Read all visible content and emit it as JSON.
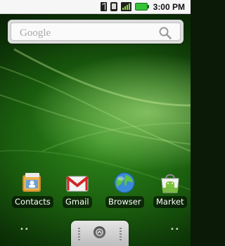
{
  "status_bar": {
    "time": "3:00 PM",
    "icons": [
      "bluetooth-icon",
      "vibrate-icon",
      "signal-icon",
      "battery-icon"
    ]
  },
  "search_widget": {
    "placeholder": "Google",
    "icon": "search-icon"
  },
  "apps": [
    {
      "label": "Contacts",
      "icon": "contacts-icon"
    },
    {
      "label": "Gmail",
      "icon": "gmail-icon"
    },
    {
      "label": "Browser",
      "icon": "browser-icon"
    },
    {
      "label": "Market",
      "icon": "market-icon"
    }
  ],
  "page_indicators": {
    "left": "••",
    "right": "••"
  },
  "app_drawer": {
    "icon": "app-drawer-icon"
  },
  "colors": {
    "wallpaper_dark": "#071b04",
    "wallpaper_mid": "#2f8a1c",
    "status_bar_bg": "#f6f6f6",
    "label_bg": "#000000"
  }
}
